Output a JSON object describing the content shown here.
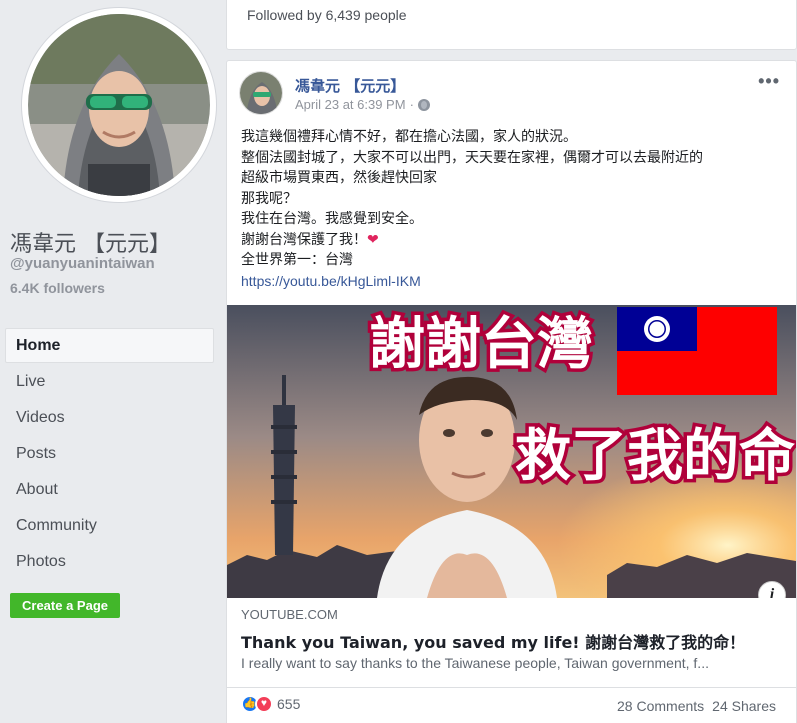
{
  "sidebar": {
    "page_name": "馮韋元 【元元】",
    "handle": "@yuanyuanintaiwan",
    "followers": "6.4K followers",
    "nav": [
      {
        "label": "Home"
      },
      {
        "label": "Live"
      },
      {
        "label": "Videos"
      },
      {
        "label": "Posts"
      },
      {
        "label": "About"
      },
      {
        "label": "Community"
      },
      {
        "label": "Photos"
      }
    ],
    "create_page_label": "Create a Page"
  },
  "top_card": {
    "followed_text": "Followed by 6,439 people"
  },
  "post": {
    "author": "馮韋元 【元元】",
    "date": "April 23 at 6:39 PM",
    "more_icon": "more-horizontal-icon",
    "privacy_icon": "globe-icon",
    "lines": [
      "我這幾個禮拜心情不好，都在擔心法國，家人的狀況。",
      "整個法國封城了，大家不可以出門，天天要在家裡，偶爾才可以去最附近的",
      "超級市場買東西，然後趕快回家",
      "那我呢？",
      "我住在台灣。我感覺到安全。",
      "謝謝台灣保護了我！",
      "全世界第一：台灣"
    ],
    "heart": "❤",
    "link_url": "https://youtu.be/kHgLiml-IKM",
    "thumbnail": {
      "text_top": "謝謝台灣",
      "text_bottom": "救了我的命"
    },
    "preview": {
      "source": "YOUTUBE.COM",
      "title": "Thank you Taiwan, you saved my life! 謝謝台灣救了我的命！",
      "description": "I really want to say thanks to the Taiwanese people, Taiwan government, f..."
    },
    "reactions_count": "655",
    "comments": "28 Comments",
    "shares": "24 Shares"
  },
  "colors": {
    "link_blue": "#385898",
    "green_button": "#42b72a",
    "flag_red": "#fe0000",
    "flag_blue": "#000095"
  }
}
